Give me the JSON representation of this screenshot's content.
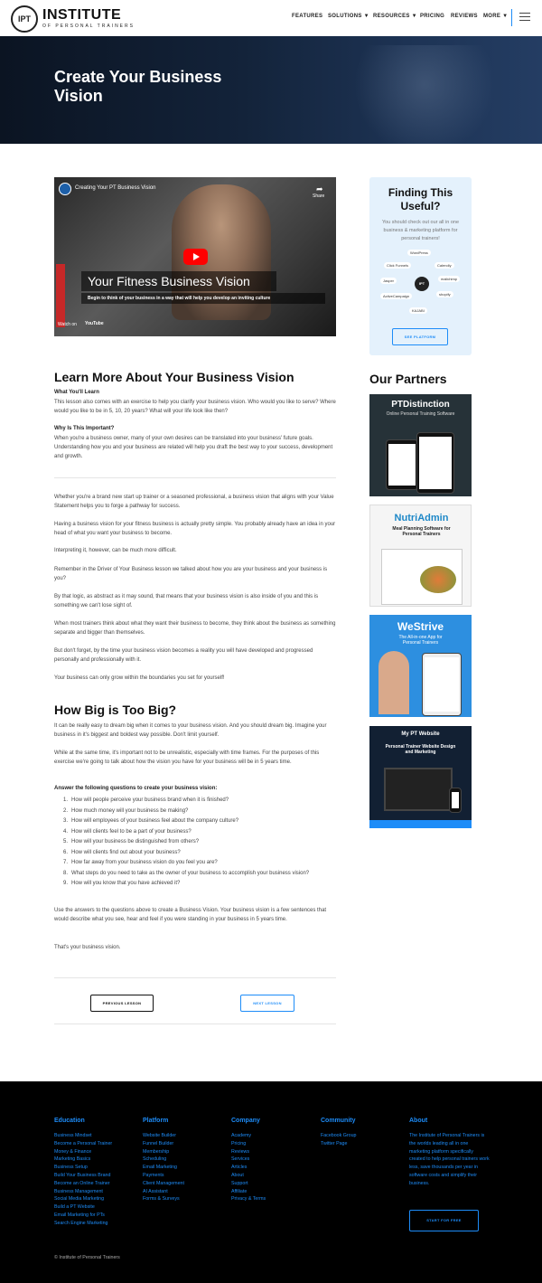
{
  "header": {
    "logo_badge": "IPT",
    "logo_title": "INSTITUTE",
    "logo_subtitle": "OF PERSONAL TRAINERS",
    "nav": [
      "FEATURES",
      "SOLUTIONS ▼",
      "RESOURCES ▼",
      "PRICING",
      "REVIEWS",
      "MORE ▼"
    ]
  },
  "hero": {
    "title": "Create Your Business Vision"
  },
  "video": {
    "channel_title": "Creating Your PT Business Vision",
    "share_label": "Share",
    "overlay_title": "Your Fitness Business Vision",
    "overlay_subtitle": "Begin to think of your business in a way that will help you develop an inviting culture",
    "watch_on": "Watch on",
    "youtube": "YouTube"
  },
  "lesson": {
    "heading": "Learn More About Your Business Vision",
    "learn_label": "What You'll Learn",
    "learn_text": "This lesson also comes with an exercise to help you clarify your business vision. Who would you like to serve? Where would you like to be in 5, 10, 20 years? What will your life look like then?",
    "why_label": "Why Is This Important?",
    "why_text": "When you're a business owner, many of your own desires can be translated into your business' future goals. Understanding how you and your business are related will help you draft the best way to your success, development and growth.",
    "paragraphs": [
      "Whether you're a brand new start up trainer or a seasoned professional, a business vision that aligns with your Value Statement helps you to forge a pathway for success.",
      "Having a business vision for your fitness business is actually pretty simple. You probably already have an idea in your head of what you want your business to become.",
      "Interpreting it, however, can be much more difficult.",
      "Remember in the Driver of Your Business lesson we talked about how you are your business and your business is you?",
      "By that logic, as abstract as it may sound, that means that your business vision is also inside of you and this is something we can't lose sight of.",
      "When most trainers think about what they want their business to become, they think about the business as something separate and bigger than themselves.",
      "But don't forget, by the time your business vision becomes a reality you will have developed and progressed personally and professionally with it.",
      "Your business can only grow within the boundaries you set for yourself!"
    ],
    "heading2": "How Big is Too Big?",
    "big_paragraphs": [
      "It can be really easy to dream big when it comes to your business vision. And you should dream big. Imagine your business in it's biggest and boldest way possible. Don't limit yourself.",
      "While at the same time, it's important not to be unrealistic, especially with time frames. For the purposes of this exercise we're going to talk about how the vision you have for your business will be in 5 years time."
    ],
    "questions_label": "Answer the following questions to create your business vision:",
    "questions": [
      "How will people perceive your business brand when it is finished?",
      "How much money will your business be making?",
      "How will employees of your business feel about the company culture?",
      "How will clients feel to be a part of your business?",
      "How will your business be distinguished from others?",
      "How will clients find out about your business?",
      "How far away from your business vision do you feel you are?",
      "What steps do you need to take as the owner of your business to accomplish your business vision?",
      "How will you know that you have achieved it?"
    ],
    "closing": [
      "Use the answers to the questions above to create a Business Vision. Your business vision is a few sentences that would describe what you see, hear and feel if you were standing in your business in 5 years time.",
      "That's your business vision."
    ],
    "prev_label": "PREVIOUS LESSON",
    "next_label": "NEXT LESSON"
  },
  "sidebar": {
    "cta_title": "Finding This Useful?",
    "cta_text": "You should check out our all in one business & marketing platform for personal trainers!",
    "cta_hub": "IPT",
    "cta_nodes": [
      "WordPress",
      "Calendly",
      "mailchimp",
      "shopify",
      "KAJABI",
      "ActiveCampaign",
      "Jasper",
      "Click Funnels"
    ],
    "cta_button": "SEE PLATFORM",
    "partners_title": "Our Partners",
    "ads": [
      {
        "title": "PTDistinction",
        "sub": "Online Personal Training Software"
      },
      {
        "title": "NutriAdmin",
        "sub": "Meal Planning Software for Personal Trainers"
      },
      {
        "title": "WeStrive",
        "sub": "The All-in-one App for Personal Trainers"
      },
      {
        "title": "My PT Website",
        "sub": "Personal Trainer Website Design and Marketing"
      }
    ]
  },
  "footer": {
    "columns": [
      {
        "title": "Education",
        "items": [
          "Business Mindset",
          "Become a Personal Trainer",
          "Money & Finance",
          "Marketing Basics",
          "Business Setup",
          "Build Your Business Brand",
          "Become an Online Trainer",
          "Business Management",
          "Social Media Marketing",
          "Build a PT Website",
          "Email Marketing for PTs",
          "Search Engine Marketing"
        ]
      },
      {
        "title": "Platform",
        "items": [
          "Website Builder",
          "Funnel Builder",
          "Membership",
          "Scheduling",
          "Email Marketing",
          "Payments",
          "Client Management",
          "AI Assistant",
          "Forms & Surveys"
        ]
      },
      {
        "title": "Company",
        "items": [
          "Academy",
          "Pricing",
          "Reviews",
          "Services",
          "Articles",
          "About",
          "Support",
          "Affiliate",
          "Privacy & Terms"
        ]
      },
      {
        "title": "Community",
        "items": [
          "Facebook Group",
          "Twitter Page"
        ]
      }
    ],
    "about_title": "About",
    "about_text": "The Institute of Personal Trainers is the worlds leading all in one marketing platform specifically created to help personal trainers work less, save thousands per year in software costs and simplify their business.",
    "cta": "START FOR FREE",
    "copyright": "© Institute of Personal Trainers"
  }
}
